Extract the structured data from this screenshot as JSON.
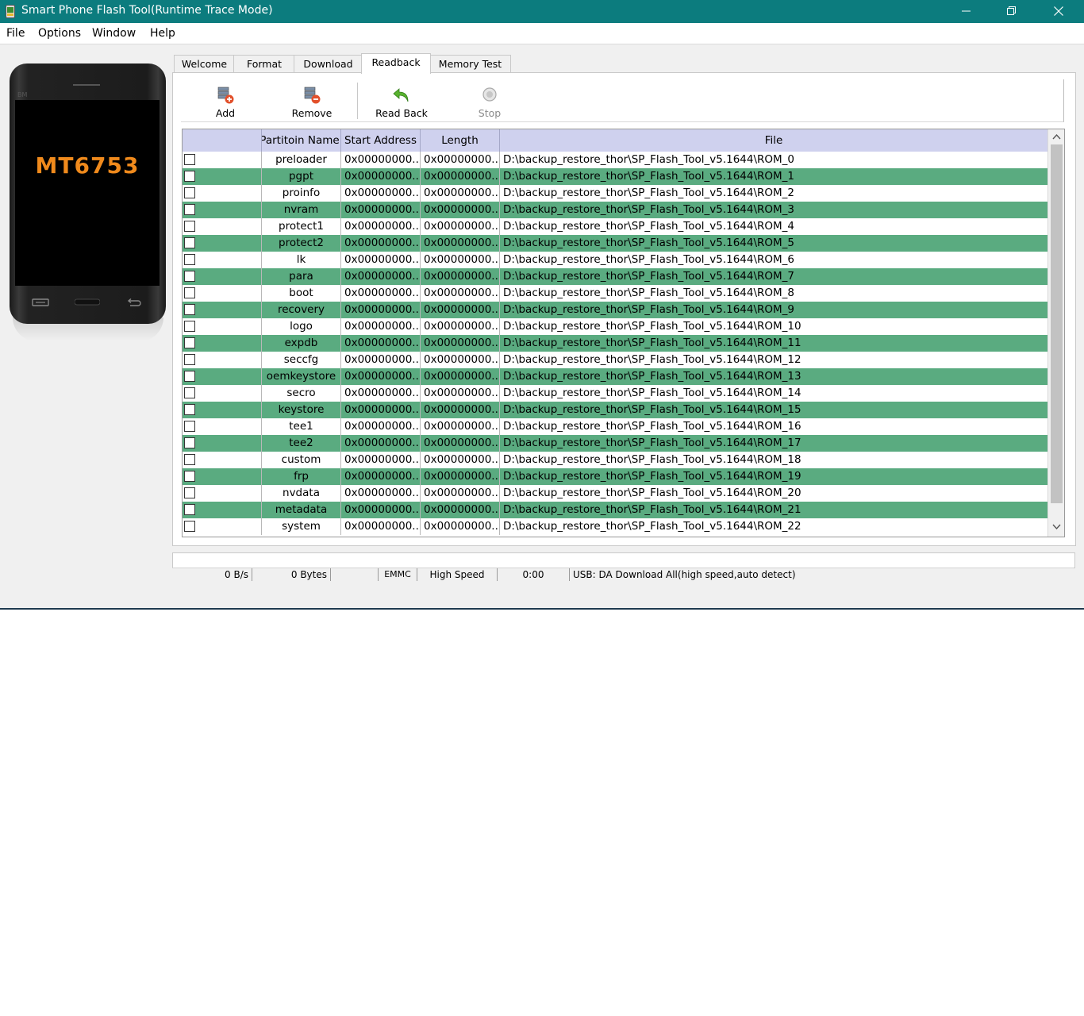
{
  "window": {
    "title": "Smart Phone Flash Tool(Runtime Trace Mode)"
  },
  "menu": [
    "File",
    "Options",
    "Window",
    "Help"
  ],
  "device": {
    "chip": "MT6753",
    "mark": "BM"
  },
  "tabs": [
    {
      "label": "Welcome",
      "active": false
    },
    {
      "label": "Format",
      "active": false
    },
    {
      "label": "Download",
      "active": false
    },
    {
      "label": "Readback",
      "active": true
    },
    {
      "label": "Memory Test",
      "active": false
    }
  ],
  "toolbar": {
    "add": "Add",
    "remove": "Remove",
    "read_back": "Read Back",
    "stop": "Stop"
  },
  "table": {
    "columns": [
      "",
      "Partitoin Name",
      "Start Address",
      "Length",
      "File"
    ],
    "rows": [
      {
        "name": "preloader",
        "start": "0x00000000...",
        "length": "0x00000000...",
        "file": "D:\\backup_restore_thor\\SP_Flash_Tool_v5.1644\\ROM_0"
      },
      {
        "name": "pgpt",
        "start": "0x00000000...",
        "length": "0x00000000...",
        "file": "D:\\backup_restore_thor\\SP_Flash_Tool_v5.1644\\ROM_1"
      },
      {
        "name": "proinfo",
        "start": "0x00000000...",
        "length": "0x00000000...",
        "file": "D:\\backup_restore_thor\\SP_Flash_Tool_v5.1644\\ROM_2"
      },
      {
        "name": "nvram",
        "start": "0x00000000...",
        "length": "0x00000000...",
        "file": "D:\\backup_restore_thor\\SP_Flash_Tool_v5.1644\\ROM_3"
      },
      {
        "name": "protect1",
        "start": "0x00000000...",
        "length": "0x00000000...",
        "file": "D:\\backup_restore_thor\\SP_Flash_Tool_v5.1644\\ROM_4"
      },
      {
        "name": "protect2",
        "start": "0x00000000...",
        "length": "0x00000000...",
        "file": "D:\\backup_restore_thor\\SP_Flash_Tool_v5.1644\\ROM_5"
      },
      {
        "name": "lk",
        "start": "0x00000000...",
        "length": "0x00000000...",
        "file": "D:\\backup_restore_thor\\SP_Flash_Tool_v5.1644\\ROM_6"
      },
      {
        "name": "para",
        "start": "0x00000000...",
        "length": "0x00000000...",
        "file": "D:\\backup_restore_thor\\SP_Flash_Tool_v5.1644\\ROM_7"
      },
      {
        "name": "boot",
        "start": "0x00000000...",
        "length": "0x00000000...",
        "file": "D:\\backup_restore_thor\\SP_Flash_Tool_v5.1644\\ROM_8"
      },
      {
        "name": "recovery",
        "start": "0x00000000...",
        "length": "0x00000000...",
        "file": "D:\\backup_restore_thor\\SP_Flash_Tool_v5.1644\\ROM_9"
      },
      {
        "name": "logo",
        "start": "0x00000000...",
        "length": "0x00000000...",
        "file": "D:\\backup_restore_thor\\SP_Flash_Tool_v5.1644\\ROM_10"
      },
      {
        "name": "expdb",
        "start": "0x00000000...",
        "length": "0x00000000...",
        "file": "D:\\backup_restore_thor\\SP_Flash_Tool_v5.1644\\ROM_11"
      },
      {
        "name": "seccfg",
        "start": "0x00000000...",
        "length": "0x00000000...",
        "file": "D:\\backup_restore_thor\\SP_Flash_Tool_v5.1644\\ROM_12"
      },
      {
        "name": "oemkeystore",
        "start": "0x00000000...",
        "length": "0x00000000...",
        "file": "D:\\backup_restore_thor\\SP_Flash_Tool_v5.1644\\ROM_13"
      },
      {
        "name": "secro",
        "start": "0x00000000...",
        "length": "0x00000000...",
        "file": "D:\\backup_restore_thor\\SP_Flash_Tool_v5.1644\\ROM_14"
      },
      {
        "name": "keystore",
        "start": "0x00000000...",
        "length": "0x00000000...",
        "file": "D:\\backup_restore_thor\\SP_Flash_Tool_v5.1644\\ROM_15"
      },
      {
        "name": "tee1",
        "start": "0x00000000...",
        "length": "0x00000000...",
        "file": "D:\\backup_restore_thor\\SP_Flash_Tool_v5.1644\\ROM_16"
      },
      {
        "name": "tee2",
        "start": "0x00000000...",
        "length": "0x00000000...",
        "file": "D:\\backup_restore_thor\\SP_Flash_Tool_v5.1644\\ROM_17"
      },
      {
        "name": "custom",
        "start": "0x00000000...",
        "length": "0x00000000...",
        "file": "D:\\backup_restore_thor\\SP_Flash_Tool_v5.1644\\ROM_18"
      },
      {
        "name": "frp",
        "start": "0x00000000...",
        "length": "0x00000000...",
        "file": "D:\\backup_restore_thor\\SP_Flash_Tool_v5.1644\\ROM_19"
      },
      {
        "name": "nvdata",
        "start": "0x00000000...",
        "length": "0x00000000...",
        "file": "D:\\backup_restore_thor\\SP_Flash_Tool_v5.1644\\ROM_20"
      },
      {
        "name": "metadata",
        "start": "0x00000000...",
        "length": "0x00000000...",
        "file": "D:\\backup_restore_thor\\SP_Flash_Tool_v5.1644\\ROM_21"
      },
      {
        "name": "system",
        "start": "0x00000000...",
        "length": "0x00000000...",
        "file": "D:\\backup_restore_thor\\SP_Flash_Tool_v5.1644\\ROM_22"
      }
    ]
  },
  "status": {
    "speed": "0 B/s",
    "bytes": "0 Bytes",
    "blank": "",
    "storage": "EMMC",
    "mode": "High Speed",
    "time": "0:00",
    "connection": "USB: DA Download All(high speed,auto detect)"
  },
  "colors": {
    "titlebar": "#0c7c7e",
    "row_highlight": "#5aab80",
    "header": "#cfd1ee",
    "chip_label": "#f08a1c"
  },
  "icons": [
    "app-icon",
    "minimize-icon",
    "maximize-icon",
    "close-icon",
    "add-icon",
    "remove-icon",
    "read-back-icon",
    "stop-icon",
    "scroll-up-icon",
    "scroll-down-icon"
  ]
}
